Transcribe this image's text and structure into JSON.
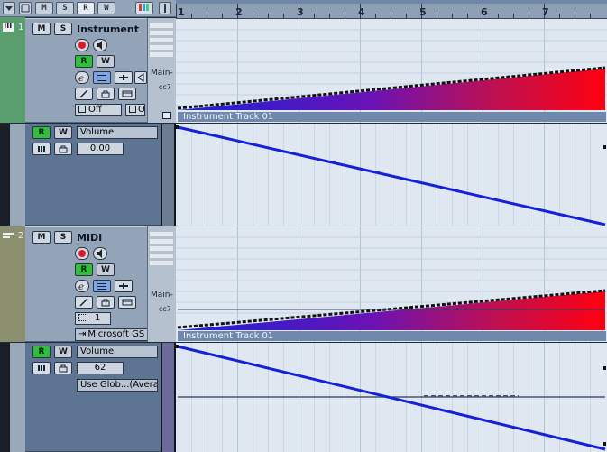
{
  "toolbar": {
    "buttons": [
      {
        "label": "",
        "name": "collapse"
      },
      {
        "label": "",
        "name": "show-all"
      },
      {
        "label": "M",
        "name": "mute-all"
      },
      {
        "label": "S",
        "name": "solo-all"
      },
      {
        "label": "R",
        "name": "read-all"
      },
      {
        "label": "W",
        "name": "write-all"
      }
    ]
  },
  "ruler": {
    "bars": [
      "1",
      "2",
      "3",
      "4",
      "5",
      "6",
      "7"
    ]
  },
  "tracks": [
    {
      "number": "1",
      "name": "Instrument",
      "mute": "M",
      "solo": "S",
      "read": "R",
      "write": "W",
      "output_field": "Off",
      "output_field2": "O",
      "mini_label": "Main-",
      "cc_label": "cc7",
      "event_title": "Instrument Track 01",
      "color": "#5a9e6f",
      "automation": {
        "read": "R",
        "write": "W",
        "param": "Volume",
        "value": "0.00"
      }
    },
    {
      "number": "2",
      "name": "MIDI",
      "mute": "M",
      "solo": "S",
      "read": "R",
      "write": "W",
      "channel_field": "1",
      "device_field": "Microsoft GS",
      "mini_label": "Main-",
      "cc_label": "cc7",
      "event_title": "Instrument Track 01",
      "color": "#8c8f6e",
      "automation": {
        "read": "R",
        "write": "W",
        "param": "Volume",
        "value": "62",
        "mode": "Use Glob...(Avera"
      }
    }
  ],
  "colors": {
    "ramp_start": "#1a22d8",
    "ramp_end": "#ff0010",
    "automation_line": "#1521d6",
    "record_red": "#e0182a",
    "rw_green": "#2fbf3c"
  }
}
